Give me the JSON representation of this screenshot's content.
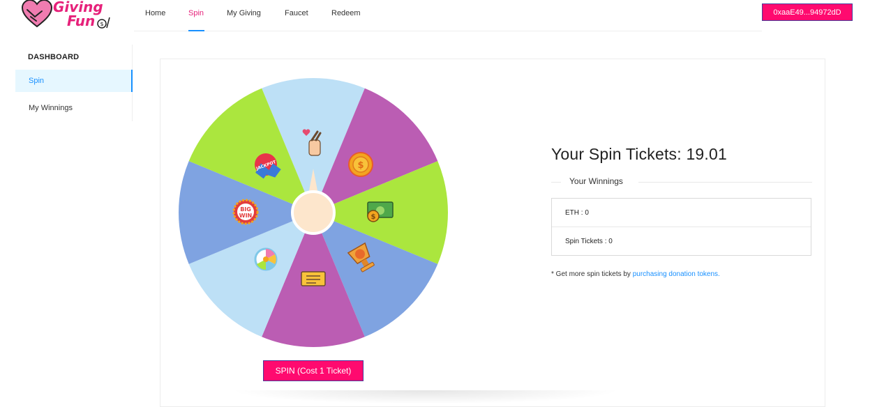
{
  "brand": {
    "line1": "Giving",
    "line2": "Fun"
  },
  "nav": {
    "items": [
      {
        "label": "Home"
      },
      {
        "label": "Spin"
      },
      {
        "label": "My Giving"
      },
      {
        "label": "Faucet"
      },
      {
        "label": "Redeem"
      }
    ],
    "active": "Spin"
  },
  "wallet": {
    "address": "0xaaE49...94972dD"
  },
  "sidebar": {
    "title": "DASHBOARD",
    "items": [
      {
        "label": "Spin"
      },
      {
        "label": "My Winnings"
      }
    ],
    "active": "Spin"
  },
  "wheel": {
    "segment_colors": [
      "#bde0f6",
      "#bb5db3",
      "#abe63e",
      "#7fa3e1",
      "#bb5db3",
      "#bde0f6",
      "#7fa3e1",
      "#abe63e"
    ],
    "prize_icons": [
      "heart-fingers-icon",
      "coin-icon",
      "money-bill-icon",
      "trophy-coin-icon",
      "ticket-icon",
      "spin-wheel-icon",
      "big-win-badge-icon",
      "jackpot-badge-icon"
    ]
  },
  "spin_button": {
    "label": "SPIN (Cost 1 Ticket)"
  },
  "tickets": {
    "title": "Your Spin Tickets: 19.01"
  },
  "winnings": {
    "header": "Your Winnings",
    "rows": [
      {
        "label": "ETH : 0"
      },
      {
        "label": "Spin Tickets : 0"
      }
    ]
  },
  "note": {
    "text": "* Get more spin tickets by ",
    "link": "purchasing donation tokens."
  },
  "colors": {
    "accent": "#ff0a6f",
    "brand_pink": "#e6217a",
    "active_blue": "#1890ff"
  }
}
